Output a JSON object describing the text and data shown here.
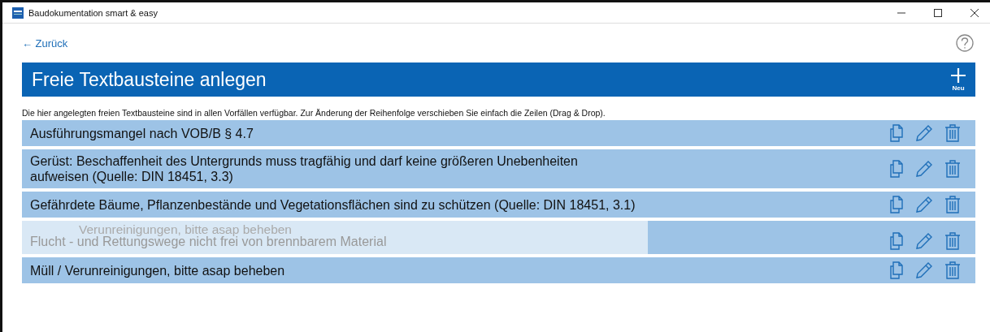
{
  "window": {
    "title": "Baudokumentation smart & easy"
  },
  "back_link": "← Zurück",
  "header": {
    "title": "Freie Textbausteine anlegen",
    "new_button": "Neu"
  },
  "description": "Die hier angelegten freien Textbausteine sind in allen Vorfällen verfügbar. Zur Änderung der Reihenfolge verschieben Sie einfach die Zeilen (Drag & Drop).",
  "rows": [
    {
      "text": "Ausführungsmangel nach VOB/B § 4.7",
      "dragging": false
    },
    {
      "text": "Gerüst: Beschaffenheit des Untergrunds muss tragfähig und darf keine größeren Unebenheiten aufweisen (Quelle: DIN 18451, 3.3)",
      "dragging": false
    },
    {
      "text": "Gefährdete Bäume, Pflanzenbestände und Vegetationsflächen sind zu schützen (Quelle: DIN 18451, 3.1)",
      "dragging": false
    },
    {
      "text": "Flucht - und Rettungswege nicht frei von brennbarem Material",
      "dragging": true,
      "drag_ghost": "Verunreinigungen, bitte asap beheben"
    },
    {
      "text": "Müll / Verunreinigungen, bitte asap beheben",
      "dragging": false
    }
  ]
}
